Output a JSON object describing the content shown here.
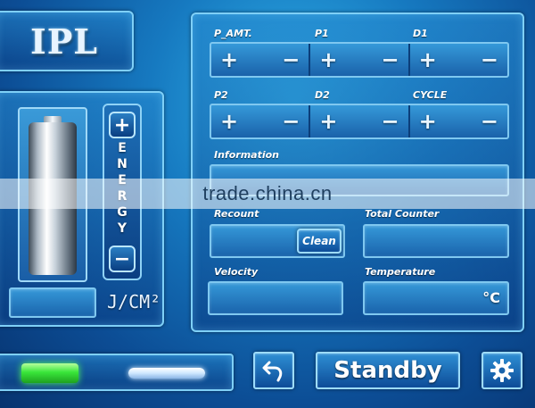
{
  "title": "IPL",
  "energy": {
    "plus": "+",
    "minus": "−",
    "letters": [
      "E",
      "N",
      "E",
      "R",
      "G",
      "Y"
    ],
    "value": "",
    "unit": "J/CM²"
  },
  "params": {
    "row1": [
      {
        "label": "P_AMT.",
        "plus": "+",
        "minus": "−"
      },
      {
        "label": "P1",
        "plus": "+",
        "minus": "−"
      },
      {
        "label": "D1",
        "plus": "+",
        "minus": "−"
      }
    ],
    "row2": [
      {
        "label": "P2",
        "plus": "+",
        "minus": "−"
      },
      {
        "label": "D2",
        "plus": "+",
        "minus": "−"
      },
      {
        "label": "CYCLE",
        "plus": "+",
        "minus": "−"
      }
    ]
  },
  "information": {
    "label": "Information",
    "value": ""
  },
  "recount": {
    "label": "Recount",
    "value": "",
    "clean_button": "Clean"
  },
  "total_counter": {
    "label": "Total Counter",
    "value": ""
  },
  "velocity": {
    "label": "Velocity",
    "value": ""
  },
  "temperature": {
    "label": "Temperature",
    "value": "",
    "unit": "°C"
  },
  "footer": {
    "status_indicator_color": "#39e63a",
    "standby_button": "Standby"
  },
  "watermark": "trade.china.cn",
  "colors": {
    "accent": "#7fd0f7",
    "background_dark": "#07336f",
    "status_green": "#39e63a"
  },
  "icons": {
    "back": "back-arrow-icon",
    "settings": "gear-icon"
  }
}
